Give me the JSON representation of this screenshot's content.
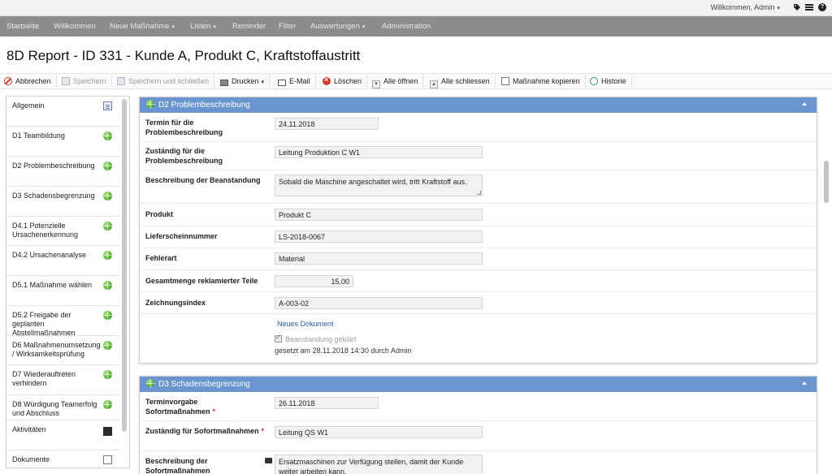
{
  "topbar": {
    "welcome": "Willkommen, Admin",
    "icons": [
      "tag-icon",
      "list-icon",
      "help-icon"
    ]
  },
  "nav": {
    "items": [
      {
        "label": "Startseite",
        "dropdown": false
      },
      {
        "label": "Willkommen",
        "dropdown": false
      },
      {
        "label": "Neue Maßnahme",
        "dropdown": true
      },
      {
        "label": "Listen",
        "dropdown": true
      },
      {
        "label": "Reminder",
        "dropdown": false
      },
      {
        "label": "Filter",
        "dropdown": false
      },
      {
        "label": "Auswertungen",
        "dropdown": true
      },
      {
        "label": "Administration",
        "dropdown": false
      }
    ]
  },
  "page": {
    "title": "8D Report - ID 331 - Kunde A, Produkt C, Kraftstoffaustritt"
  },
  "toolbar": {
    "cancel": "Abbrechen",
    "save": "Speichern",
    "save_close": "Speichern und schließen",
    "print": "Drucken",
    "email": "E-Mail",
    "delete": "Löschen",
    "open_all": "Alle öffnen",
    "close_all": "Alle schliessen",
    "copy": "Maßnahme kopieren",
    "history": "Historie"
  },
  "sidebar": {
    "items": [
      {
        "label": "Allgemein",
        "icon": "document-icon"
      },
      {
        "label": "D1 Teambildung",
        "icon": "green-globe-icon"
      },
      {
        "label": "D2 Problembeschreibung",
        "icon": "green-globe-icon"
      },
      {
        "label": "D3 Schadensbegrenzung",
        "icon": "green-globe-icon"
      },
      {
        "label": "D4.1 Potenzielle Ursachenerkennung",
        "icon": "green-globe-icon"
      },
      {
        "label": "D4.2 Ursachenanalyse",
        "icon": "green-globe-icon"
      },
      {
        "label": "D5.1 Maßnahme wählen",
        "icon": "green-globe-icon"
      },
      {
        "label": "D5.2 Freigabe der geplanten Abstellmaßnahmen",
        "icon": "green-globe-icon"
      },
      {
        "label": "D6 Maßnahmenumsetzung / Wirksamkeitsprüfung",
        "icon": "green-globe-icon"
      },
      {
        "label": "D7 Wiederauftreten verhindern",
        "icon": "green-globe-icon"
      },
      {
        "label": "D8 Würdigung Teamerfolg und Abschluss",
        "icon": "green-globe-icon"
      },
      {
        "label": "Aktivitäten",
        "icon": "activity-list-icon"
      },
      {
        "label": "Dokumente",
        "icon": "documents-icon"
      }
    ]
  },
  "d2": {
    "title": "D2 Problembeschreibung",
    "fields": {
      "termin": {
        "label": "Termin für die Problembeschreibung",
        "value": "24.11.2018"
      },
      "zustaendig": {
        "label": "Zuständig für die Problembeschreibung",
        "value": "Leitung Produktion C W1"
      },
      "beschreibung": {
        "label": "Beschreibung der Beanstandung",
        "value": "Sobald die Maschine angeschaltet wird, tritt Kraftstoff aus."
      },
      "produkt": {
        "label": "Produkt",
        "value": "Produkt C"
      },
      "lieferschein": {
        "label": "Lieferscheinnummer",
        "value": "LS-2018-0067"
      },
      "fehlerart": {
        "label": "Fehlerart",
        "value": "Material"
      },
      "menge": {
        "label": "Gesamtmenge reklamierter Teile",
        "value": "15,00"
      },
      "zeichnung": {
        "label": "Zeichnungsindex",
        "value": "A-003-02"
      }
    },
    "new_document": "Neues Dokument",
    "checkbox": "Beanstandung geklärt",
    "set_info": "gesetzt am 28.11.2018 14:30 durch Admin"
  },
  "d3": {
    "title": "D3 Schadensbegrenzung",
    "fields": {
      "terminvorgabe": {
        "label": "Terminvorgabe Sofortmaßnahmen",
        "value": "26.11.2018"
      },
      "zustaendig": {
        "label": "Zuständig für Sofortmaßnahmen",
        "value": "Leitung QS W1"
      },
      "beschreibung": {
        "label": "Beschreibung der Sofortmaßnahmen",
        "value": "Ersatzmaschinen zur Verfügung stellen, damit der Kunde weiter arbeiten kann."
      }
    },
    "required_mark": "*"
  }
}
